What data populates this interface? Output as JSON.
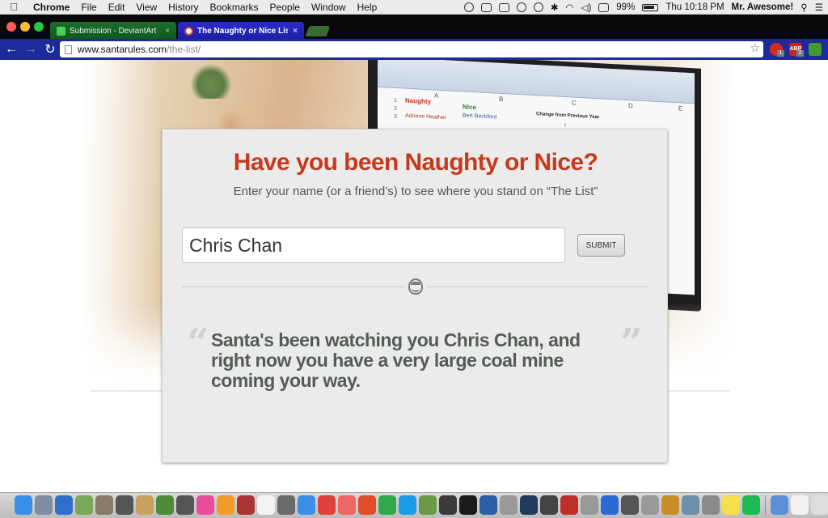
{
  "menubar": {
    "app_name": "Chrome",
    "menus": [
      "File",
      "Edit",
      "View",
      "History",
      "Bookmarks",
      "People",
      "Window",
      "Help"
    ],
    "battery_percent": "99%",
    "clock": "Thu 10:18 PM",
    "user": "Mr. Awesome!",
    "status_icons": [
      "creative-cloud-icon",
      "adobe-icon",
      "airplay-icon",
      "accessibility-icon",
      "time-machine-icon",
      "bluetooth-icon",
      "wifi-icon",
      "volume-icon",
      "input-source-icon",
      "battery-icon",
      "spotlight-icon",
      "notification-center-icon"
    ]
  },
  "tabs": [
    {
      "title": "Submission - DeviantArt",
      "icon": "deviantart-icon"
    },
    {
      "title": "The Naughty or Nice List |",
      "icon": "santa-icon",
      "active": true
    }
  ],
  "toolbar": {
    "url_host": "www.santarules.com",
    "url_path": "/the-list/",
    "extensions": [
      {
        "name": "extension-red-icon",
        "badge": "1"
      },
      {
        "name": "adblock-plus-icon",
        "label": "ABP",
        "badge": "2"
      },
      {
        "name": "extension-green-icon"
      }
    ]
  },
  "spreadsheet": {
    "columns": [
      "A",
      "B",
      "C",
      "D",
      "E"
    ],
    "rows": [
      "1",
      "2",
      "3"
    ],
    "naughty_header": "Naughty",
    "nice_header": "Nice",
    "change_header": "Change from Previous Year",
    "naughty_name": "Adriene Heather",
    "nice_name": "Bert Beckford",
    "arrow": "↑"
  },
  "card": {
    "headline": "Have you been Naughty or Nice?",
    "subline": "Enter your name (or a friend’s) to see where you stand on “The List”",
    "name_value": "Chris Chan",
    "submit_label": "SUBMIT",
    "quote_open": "“",
    "quote_close": "”",
    "result": "Santa's been watching you Chris Chan, and right now you have a very large coal mine coming your way."
  },
  "dock": {
    "apps": [
      {
        "name": "finder-icon",
        "color": "#3b8ee8"
      },
      {
        "name": "launchpad-icon",
        "color": "#7d8ea3"
      },
      {
        "name": "google-earth-icon",
        "color": "#2f6fc9"
      },
      {
        "name": "paint-icon",
        "color": "#78a85a"
      },
      {
        "name": "photos-app-icon",
        "color": "#8a7a6a"
      },
      {
        "name": "dashboard-icon",
        "color": "#555"
      },
      {
        "name": "notes-icon",
        "color": "#c9a15e"
      },
      {
        "name": "plant-app-icon",
        "color": "#4d8a3a"
      },
      {
        "name": "activity-monitor-icon",
        "color": "#555"
      },
      {
        "name": "itunes-icon",
        "color": "#ec4d9a"
      },
      {
        "name": "ibooks-icon",
        "color": "#f29b2a"
      },
      {
        "name": "photo-booth-icon",
        "color": "#a33"
      },
      {
        "name": "calendar-icon",
        "color": "#f2f2f2"
      },
      {
        "name": "compass-app-icon",
        "color": "#6a6a6a"
      },
      {
        "name": "safari-icon",
        "color": "#3a8ee6"
      },
      {
        "name": "chrome-icon",
        "color": "#e0413a"
      },
      {
        "name": "pages-icon",
        "color": "#e66"
      },
      {
        "name": "app-p-icon",
        "color": "#e14c2b"
      },
      {
        "name": "app-x-icon",
        "color": "#2fa84a"
      },
      {
        "name": "skype-icon",
        "color": "#1a9be6"
      },
      {
        "name": "minecraft-icon",
        "color": "#6a9a45"
      },
      {
        "name": "steam-game-icon",
        "color": "#3a3a3a"
      },
      {
        "name": "terminal-icon",
        "color": "#1a1a1a"
      },
      {
        "name": "word-icon",
        "color": "#2b5fa8"
      },
      {
        "name": "unknown-app-icon",
        "color": "#999"
      },
      {
        "name": "steam-icon",
        "color": "#1f3a5a"
      },
      {
        "name": "game-controller-icon",
        "color": "#444"
      },
      {
        "name": "boxing-glove-icon",
        "color": "#c0302a"
      },
      {
        "name": "unknown-app-2-icon",
        "color": "#999"
      },
      {
        "name": "quicktime-icon",
        "color": "#2a6ad1"
      },
      {
        "name": "feather-app-icon",
        "color": "#555"
      },
      {
        "name": "unknown-app-3-icon",
        "color": "#999"
      },
      {
        "name": "garageband-icon",
        "color": "#c98d2a"
      },
      {
        "name": "preview-icon",
        "color": "#6f8fa8"
      },
      {
        "name": "system-preferences-icon",
        "color": "#8a8a8a"
      },
      {
        "name": "stickies-icon",
        "color": "#f4e04a"
      },
      {
        "name": "spotify-icon",
        "color": "#1db954"
      },
      {
        "name": "messages-icon",
        "color": "#5b8fd9"
      },
      {
        "name": "document-icon",
        "color": "#f0f0f0"
      },
      {
        "name": "notepad-icon",
        "color": "#ddd"
      },
      {
        "name": "trash-icon",
        "color": "#cfcfcf"
      }
    ]
  }
}
